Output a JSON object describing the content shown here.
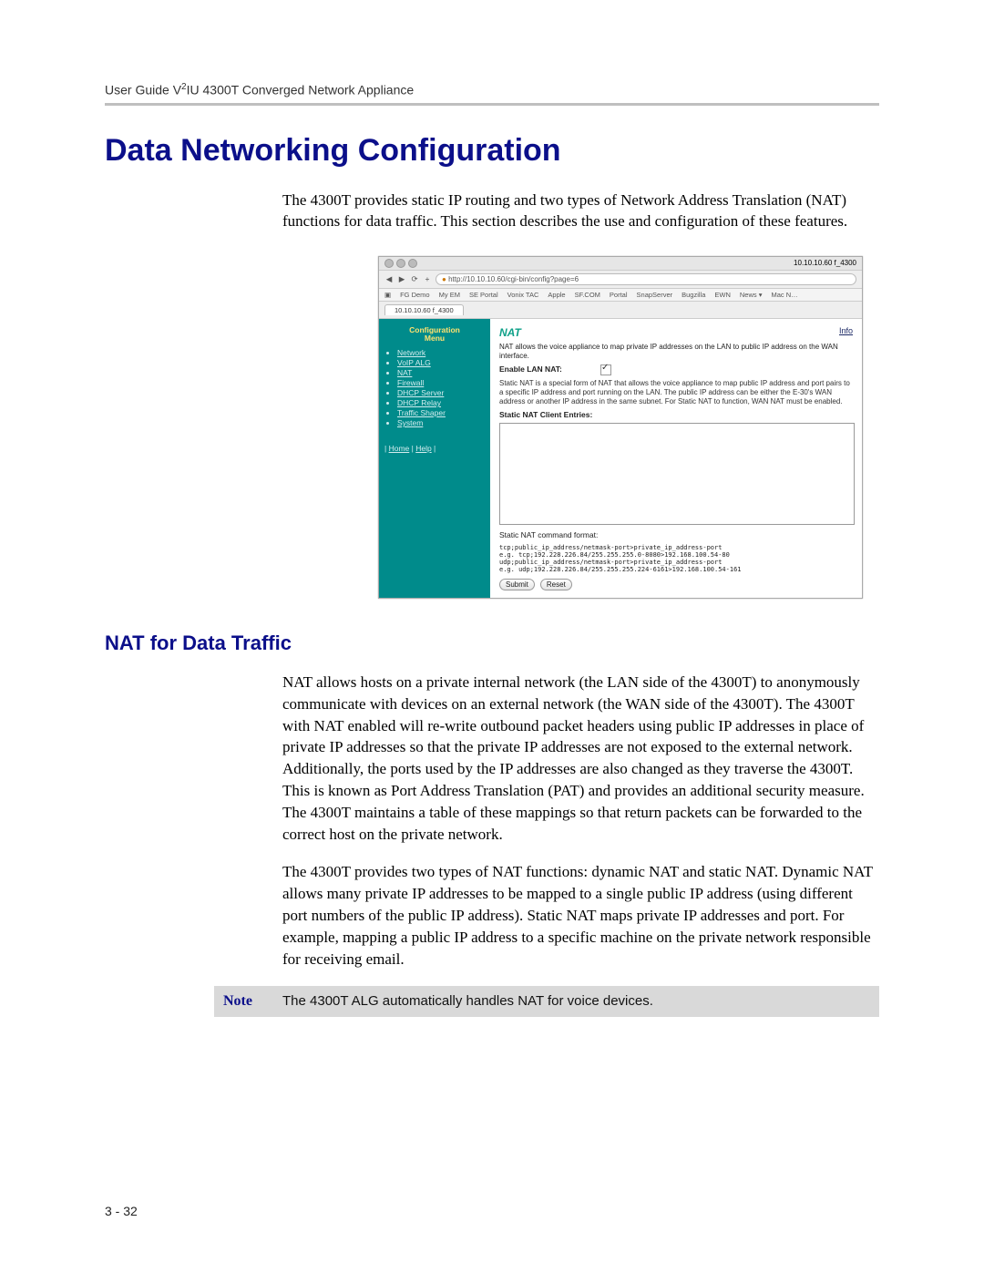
{
  "header": {
    "line": "User Guide V²IU 4300T Converged Network Appliance"
  },
  "h1": "Data Networking Configuration",
  "intro": "The 4300T provides static IP routing and two types of Network Address Translation (NAT) functions for data traffic.  This section describes the use and configuration of these features.",
  "screenshot": {
    "title_right": "10.10.10.60 f_4300",
    "url": "http://10.10.10.60/cgi-bin/config?page=6",
    "bookmarks": [
      "FG Demo",
      "My EM",
      "SE Portal",
      "Vonix TAC",
      "Apple",
      "SF.COM",
      "Portal",
      "SnapServer",
      "Bugzilla",
      "EWN",
      "News ▾",
      "Mac N…"
    ],
    "tab": "10.10.10.60 f_4300",
    "sidebar": {
      "heading": "Configuration Menu",
      "items": [
        "Network",
        "VoIP ALG",
        "NAT",
        "Firewall",
        "DHCP Server",
        "DHCP Relay",
        "Traffic Shaper",
        "System"
      ],
      "footer_links": [
        "Home",
        "Help"
      ]
    },
    "panel": {
      "heading": "NAT",
      "info_link": "Info",
      "desc": "NAT allows the voice appliance to map private IP addresses on the LAN to public IP address on the WAN interface.",
      "enable_label": "Enable LAN NAT:",
      "enable_checked": true,
      "static_desc": "Static NAT is a special form of NAT that allows the voice appliance to map public IP address and port pairs to a specific IP address and port running on the LAN. The public IP address can be either the E-30's WAN address or another IP address in the same subnet. For Static NAT to function, WAN NAT must be enabled.",
      "entries_label": "Static NAT Client Entries:",
      "cmd_label": "Static NAT command format:",
      "cmd_lines": [
        "tcp;public_ip_address/netmask-port>private_ip_address-port",
        "e.g. tcp;192.228.226.84/255.255.255.0-8080>192.168.100.54-80",
        "udp;public_ip_address/netmask-port>private_ip_address-port",
        "e.g. udp;192.228.226.84/255.255.255.224-6161>192.168.100.54-161"
      ],
      "buttons": {
        "submit": "Submit",
        "reset": "Reset"
      }
    }
  },
  "h2": "NAT for Data Traffic",
  "p1": "NAT allows hosts on a private internal network (the LAN side of the 4300T) to anonymously communicate with devices on an external network (the WAN side of the 4300T).  The 4300T with NAT enabled will re-write outbound packet headers using public IP addresses in place of private IP addresses so that the private IP addresses are not exposed to the external network.  Additionally, the ports used by the IP addresses are also changed as they traverse the 4300T.  This is known as Port Address Translation (PAT) and provides an additional security measure.  The 4300T maintains a table of these mappings so that return packets can be forwarded to the correct host on the private network.",
  "p2": "The 4300T provides two types of NAT functions:  dynamic NAT and static NAT.  Dynamic NAT allows many private IP addresses to be mapped to a single public IP address (using different port numbers of the public IP address).  Static NAT maps private IP addresses and port.  For example, mapping a public IP address to a specific machine on the private network responsible for receiving email.",
  "note": {
    "label": "Note",
    "text": "The 4300T ALG automatically handles NAT for voice devices."
  },
  "page_number": "3 - 32"
}
